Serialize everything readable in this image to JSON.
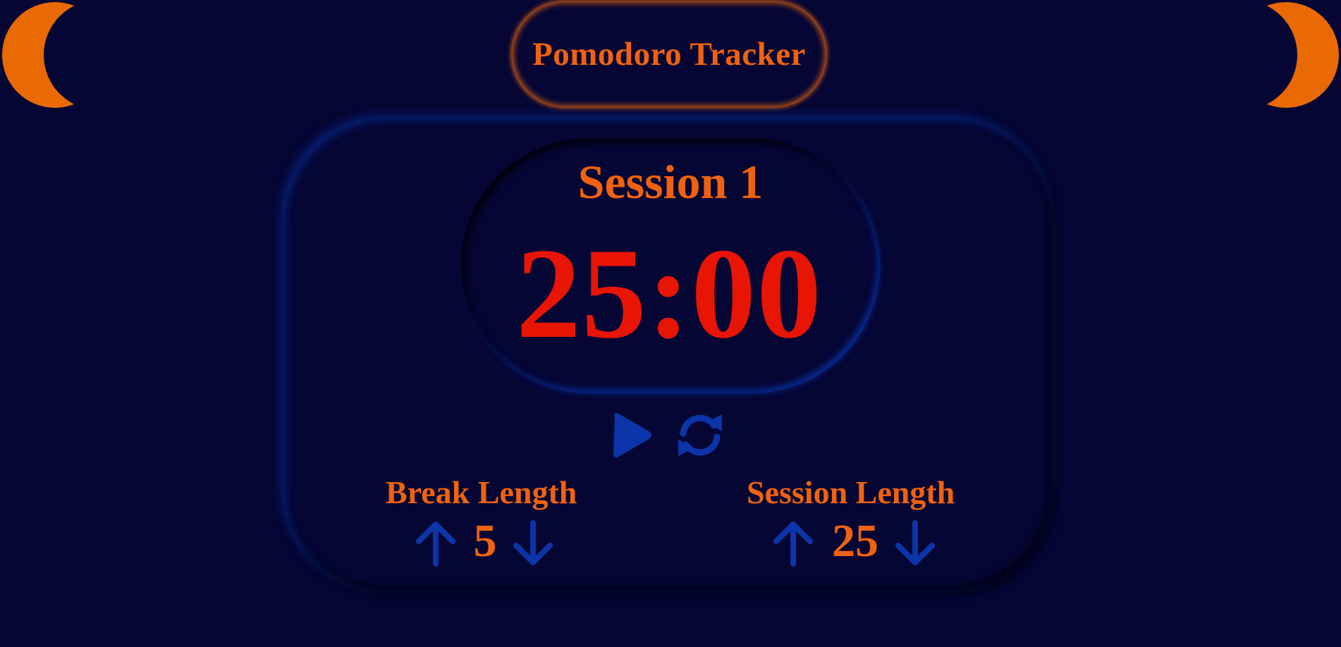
{
  "app": {
    "title": "Pomodoro Tracker"
  },
  "timer": {
    "session_label": "Session 1",
    "time_display": "25:00"
  },
  "controls": {
    "play_icon": "play-icon",
    "reset_icon": "refresh-icon"
  },
  "break_length": {
    "label": "Break Length",
    "value": "5",
    "increment_icon": "arrow-up-icon",
    "decrement_icon": "arrow-down-icon"
  },
  "session_length": {
    "label": "Session Length",
    "value": "25",
    "increment_icon": "arrow-up-icon",
    "decrement_icon": "arrow-down-icon"
  },
  "colors": {
    "background": "#050634",
    "accent_orange": "#f0620f",
    "timer_red": "#e81505",
    "icon_blue": "#0b35a8",
    "moon_orange": "#e96a05"
  }
}
